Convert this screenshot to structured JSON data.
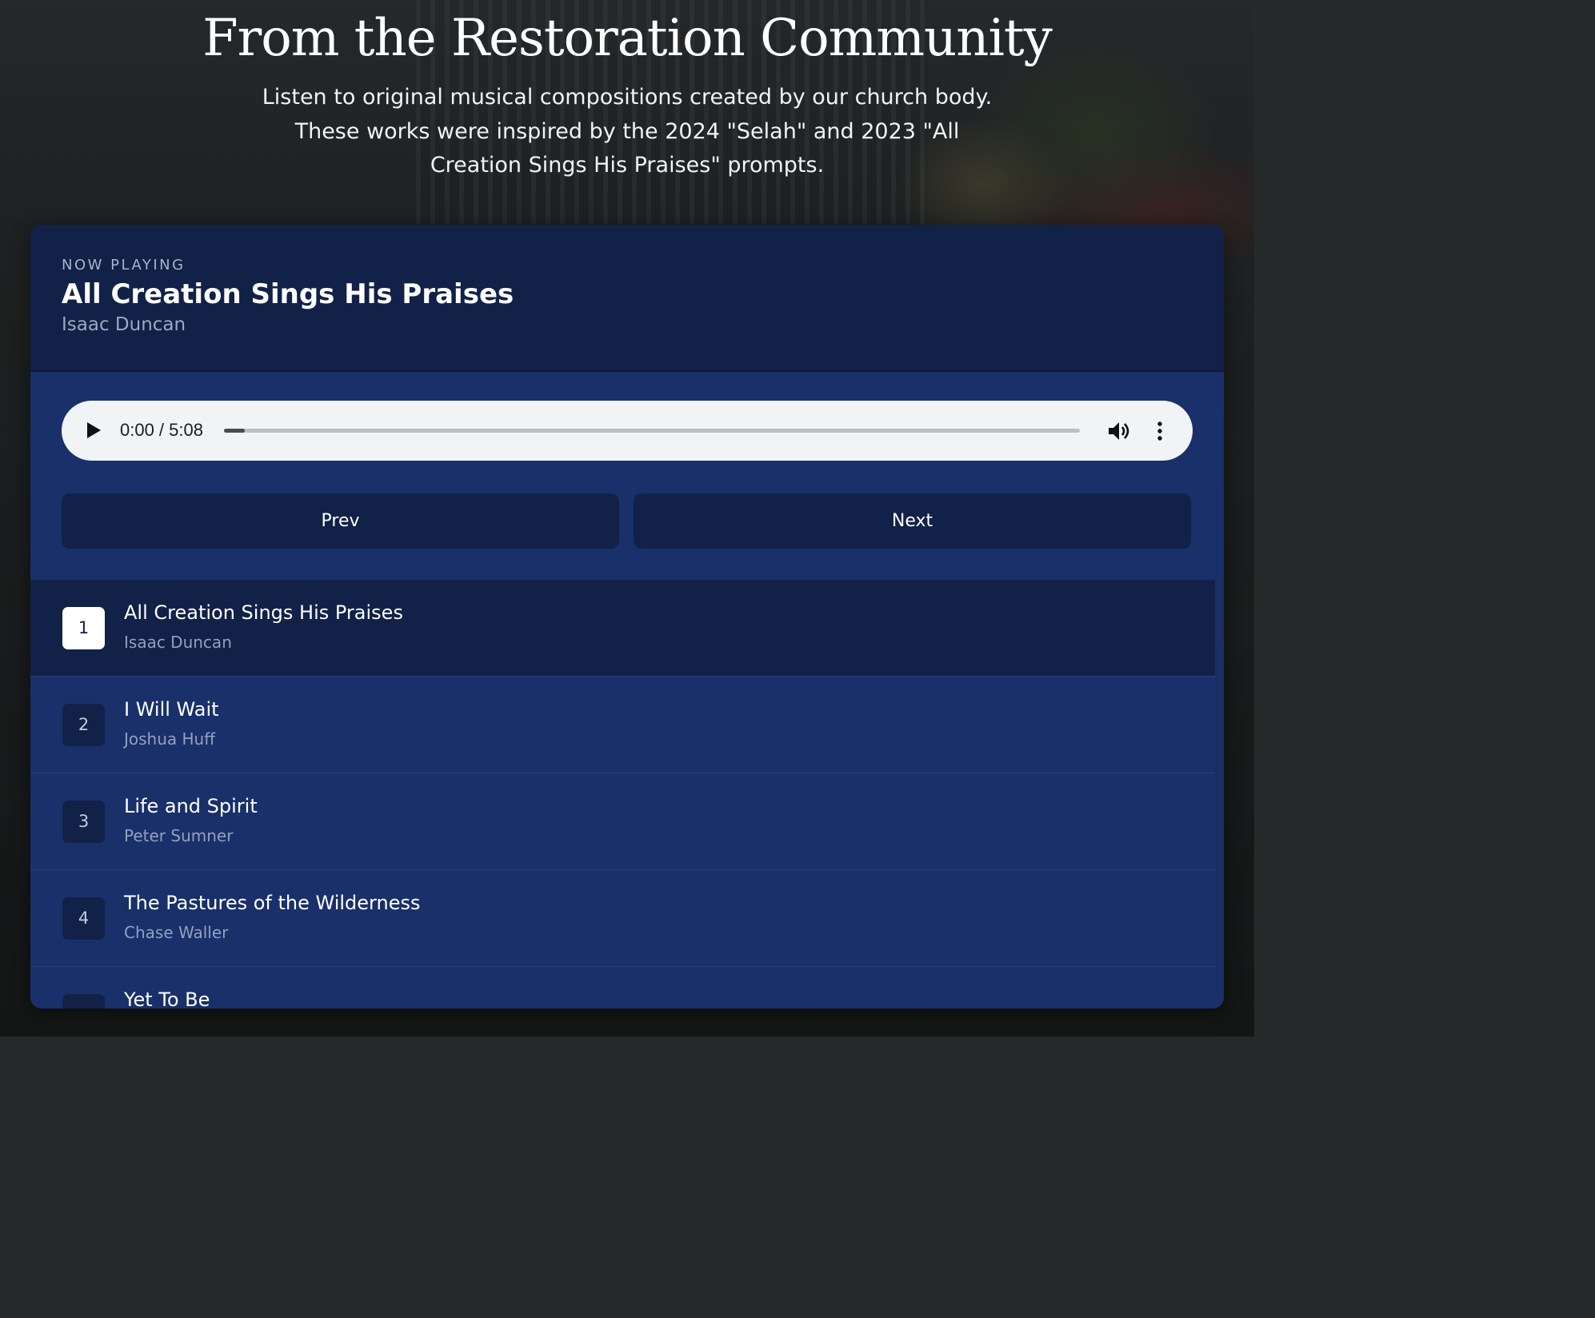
{
  "header": {
    "title": "From the Restoration Community",
    "subtitle": "Listen to original musical compositions created by our church body. These works were inspired by the 2024 \"Selah\" and 2023 \"All Creation Sings His Praises\" prompts."
  },
  "now_playing": {
    "label": "NOW PLAYING",
    "title": "All Creation Sings His Praises",
    "artist": "Isaac Duncan"
  },
  "player": {
    "time": "0:00 / 5:08",
    "progress_fraction": 0.0,
    "icons": [
      "play-icon",
      "volume-icon",
      "more-options-icon"
    ]
  },
  "controls": {
    "prev_label": "Prev",
    "next_label": "Next"
  },
  "tracks": [
    {
      "number": "1",
      "title": "All Creation Sings His Praises",
      "artist": "Isaac Duncan"
    },
    {
      "number": "2",
      "title": "I Will Wait",
      "artist": "Joshua Huff"
    },
    {
      "number": "3",
      "title": "Life and Spirit",
      "artist": "Peter Sumner"
    },
    {
      "number": "4",
      "title": "The Pastures of the Wilderness",
      "artist": "Chase Waller"
    },
    {
      "number": "",
      "title": "Yet To Be",
      "artist": ""
    }
  ],
  "colors": {
    "panel": "#19306a",
    "panel_dark": "#112148",
    "text": "#ffffff",
    "muted": "#9ea8bf"
  }
}
